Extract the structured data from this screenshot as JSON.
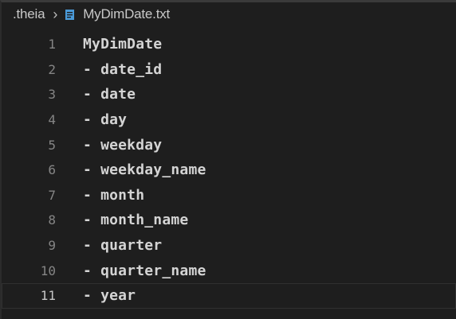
{
  "breadcrumb": {
    "folder": ".theia",
    "separator": ">",
    "file_icon": "file-text-icon",
    "file": "MyDimDate.txt"
  },
  "editor": {
    "current_line": 11,
    "lines": [
      {
        "number": "1",
        "text": "MyDimDate"
      },
      {
        "number": "2",
        "text": "- date_id"
      },
      {
        "number": "3",
        "text": "- date"
      },
      {
        "number": "4",
        "text": "- day"
      },
      {
        "number": "5",
        "text": "- weekday"
      },
      {
        "number": "6",
        "text": "- weekday_name"
      },
      {
        "number": "7",
        "text": "- month"
      },
      {
        "number": "8",
        "text": "- month_name"
      },
      {
        "number": "9",
        "text": "- quarter"
      },
      {
        "number": "10",
        "text": "- quarter_name"
      },
      {
        "number": "11",
        "text": "- year"
      }
    ]
  }
}
